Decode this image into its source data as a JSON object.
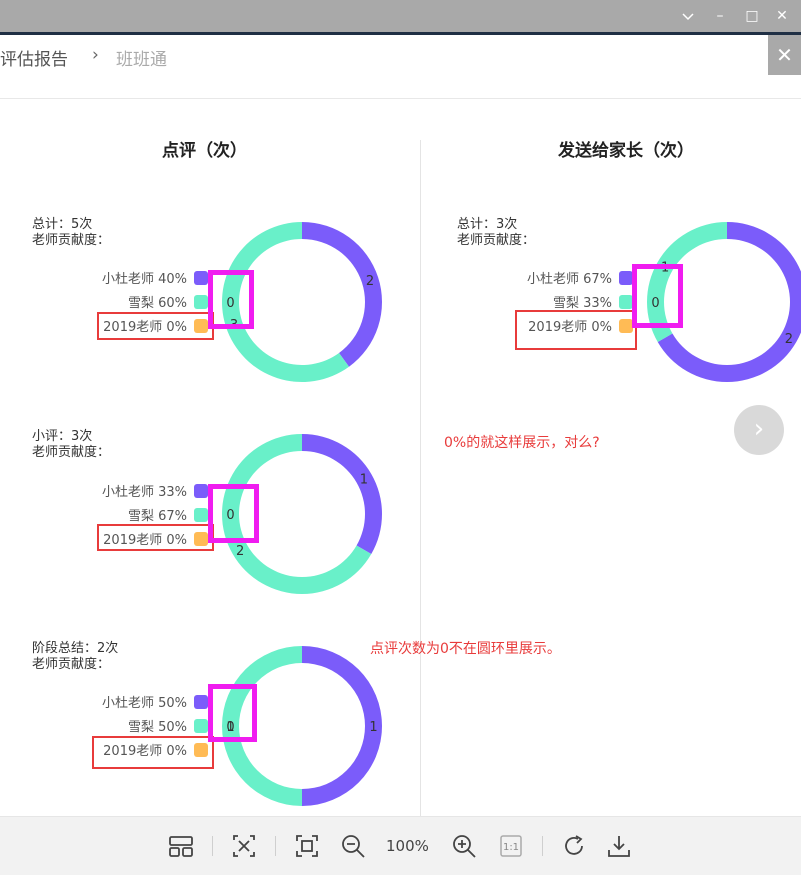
{
  "window": {
    "minimize_glyph": "–",
    "maximize_glyph": "□",
    "close_glyph": "✕",
    "menu_glyph": "⌵"
  },
  "header": {
    "breadcrumb": [
      "评估报告",
      "班班通"
    ],
    "breadcrumb_sep": "›",
    "close_glyph": "✕"
  },
  "columns": {
    "left_title": "点评（次）",
    "right_title": "发送给家长（次）"
  },
  "charts": [
    {
      "summary_line1": "总计：5次",
      "summary_line2": "老师贡献度：",
      "legend": [
        "小杜老师 40%",
        "雪梨 60%",
        "2019老师 0%"
      ],
      "segment_labels": [
        "2",
        "3",
        "0"
      ]
    },
    {
      "summary_line1": "小评：3次",
      "summary_line2": "老师贡献度：",
      "legend": [
        "小杜老师 33%",
        "雪梨 67%",
        "2019老师 0%"
      ],
      "segment_labels": [
        "1",
        "2",
        "0"
      ]
    },
    {
      "summary_line1": "阶段总结：2次",
      "summary_line2": "老师贡献度：",
      "legend": [
        "小杜老师 50%",
        "雪梨 50%",
        "2019老师 0%"
      ],
      "segment_labels": [
        "1",
        "1",
        "0"
      ]
    },
    {
      "summary_line1": "总计：3次",
      "summary_line2": "老师贡献度：",
      "legend": [
        "小杜老师 67%",
        "雪梨 33%",
        "2019老师 0%"
      ],
      "segment_labels": [
        "2",
        "1",
        "0"
      ]
    }
  ],
  "chart_data": [
    {
      "type": "pie",
      "categories": [
        "小杜老师",
        "雪梨",
        "2019老师"
      ],
      "values": [
        2,
        3,
        0
      ],
      "colors": [
        "#7b5cfa",
        "#69f0c9",
        "#ffbb55"
      ]
    },
    {
      "type": "pie",
      "categories": [
        "小杜老师",
        "雪梨",
        "2019老师"
      ],
      "values": [
        1,
        2,
        0
      ],
      "colors": [
        "#7b5cfa",
        "#69f0c9",
        "#ffbb55"
      ]
    },
    {
      "type": "pie",
      "categories": [
        "小杜老师",
        "雪梨",
        "2019老师"
      ],
      "values": [
        1,
        1,
        0
      ],
      "colors": [
        "#7b5cfa",
        "#69f0c9",
        "#ffbb55"
      ]
    },
    {
      "type": "pie",
      "categories": [
        "小杜老师",
        "雪梨",
        "2019老师"
      ],
      "values": [
        2,
        1,
        0
      ],
      "colors": [
        "#7b5cfa",
        "#69f0c9",
        "#ffbb55"
      ]
    }
  ],
  "annotations": {
    "note1": "0%的就这样展示，对么?",
    "note2": "点评次数为0不在圆环里展示。",
    "red_color": "#e83b3b",
    "magenta_color": "#f01cf0"
  },
  "navigation": {
    "next_glyph": "›"
  },
  "toolbar": {
    "zoom_level": "100%",
    "actual_size_label": "1:1",
    "icons": [
      "gallery-icon",
      "fit-width-icon",
      "fit-screen-icon",
      "zoom-out-icon",
      "zoom-in-icon",
      "actual-size-icon",
      "rotate-icon",
      "download-icon"
    ]
  }
}
